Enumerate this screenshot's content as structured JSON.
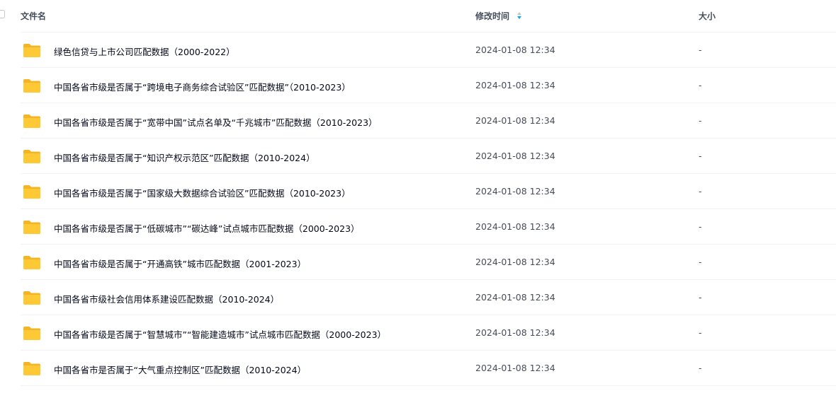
{
  "header": {
    "name_label": "文件名",
    "time_label": "修改时间",
    "size_label": "大小"
  },
  "colors": {
    "folder": "#ffc935",
    "folder_back": "#f5b425",
    "sort_active": "#06a7ff"
  },
  "files": [
    {
      "name": "绿色信贷与上市公司匹配数据（2000-2022）",
      "time": "2024-01-08 12:34",
      "size": "-",
      "icon": "folder-icon"
    },
    {
      "name": "中国各省市级是否属于“跨境电子商务综合试验区”匹配数据”（2010-2023）",
      "time": "2024-01-08 12:34",
      "size": "-",
      "icon": "folder-icon"
    },
    {
      "name": "中国各省市级是否属于“宽带中国”试点名单及“千兆城市”匹配数据（2010-2023）",
      "time": "2024-01-08 12:34",
      "size": "-",
      "icon": "folder-icon"
    },
    {
      "name": "中国各省市级是否属于“知识产权示范区”匹配数据（2010-2024）",
      "time": "2024-01-08 12:34",
      "size": "-",
      "icon": "folder-icon"
    },
    {
      "name": "中国各省市级是否属于“国家级大数据综合试验区”匹配数据（2010-2023）",
      "time": "2024-01-08 12:34",
      "size": "-",
      "icon": "folder-icon"
    },
    {
      "name": "中国各省市级是否属于“低碳城市”“碳达峰”试点城市匹配数据（2000-2023）",
      "time": "2024-01-08 12:34",
      "size": "-",
      "icon": "folder-icon"
    },
    {
      "name": "中国各省市级是否属于“开通高铁”城市匹配数据（2001-2023）",
      "time": "2024-01-08 12:34",
      "size": "-",
      "icon": "folder-icon"
    },
    {
      "name": "中国各省市级社会信用体系建设匹配数据（2010-2024）",
      "time": "2024-01-08 12:34",
      "size": "-",
      "icon": "folder-icon"
    },
    {
      "name": "中国各省市级是否属于“智慧城市”“智能建造城市”试点城市匹配数据（2000-2023）",
      "time": "2024-01-08 12:34",
      "size": "-",
      "icon": "folder-icon"
    },
    {
      "name": "中国各省市是否属于“大气重点控制区”匹配数据（2010-2024）",
      "time": "2024-01-08 12:34",
      "size": "-",
      "icon": "folder-icon"
    }
  ]
}
